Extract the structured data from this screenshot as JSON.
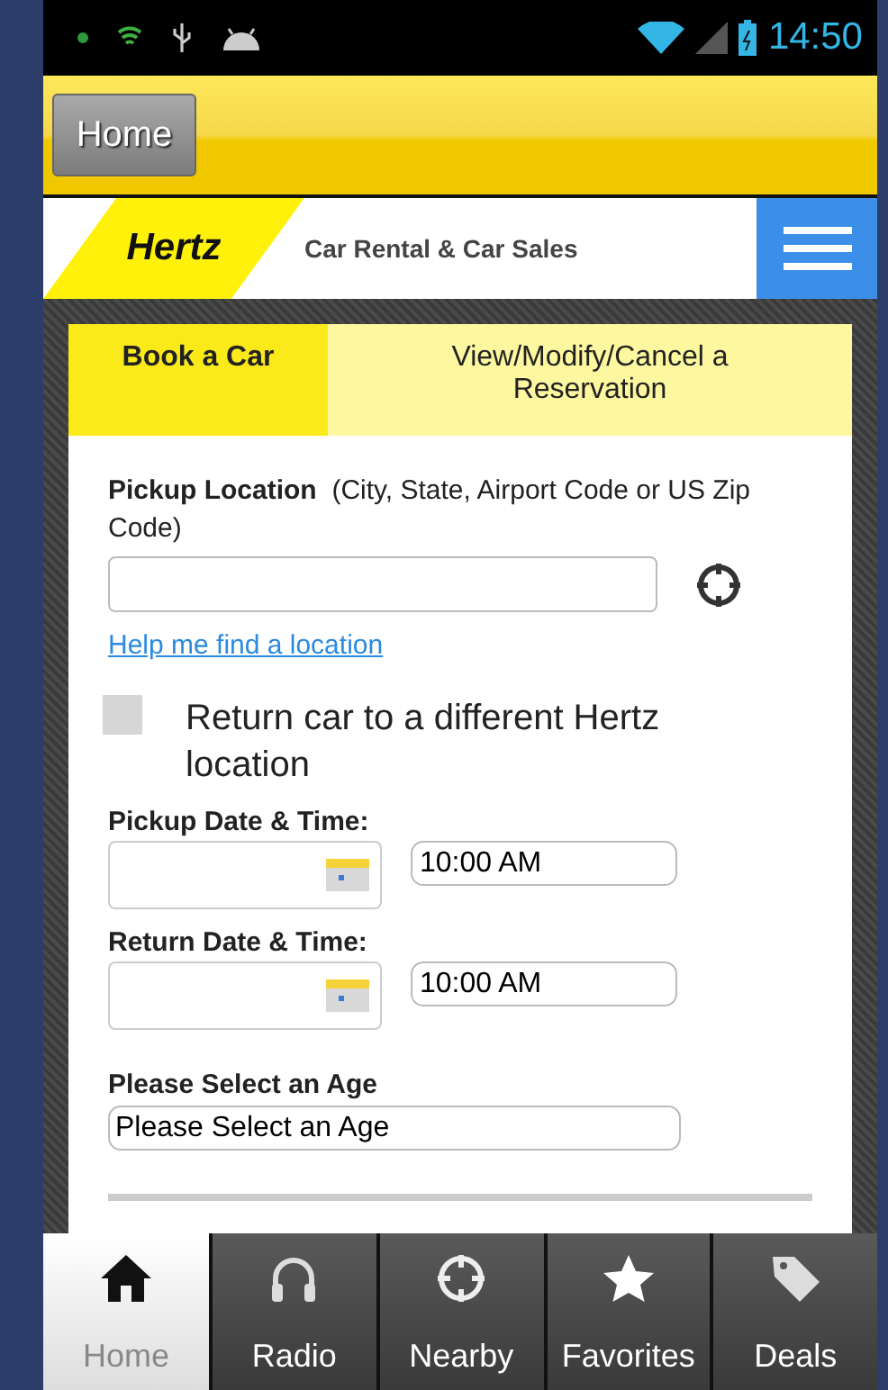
{
  "status_bar": {
    "time": "14:50"
  },
  "header": {
    "home_button": "Home"
  },
  "brand": {
    "logo": "Hertz",
    "tagline": "Car Rental & Car Sales"
  },
  "tabs": [
    {
      "label": "Book a Car",
      "selected": true
    },
    {
      "label": "View/Modify/Cancel a Reservation",
      "selected": false
    }
  ],
  "form": {
    "pickup_label": "Pickup Location",
    "pickup_hint": "(City, State, Airport Code or US Zip Code)",
    "help_link": "Help me find a location",
    "return_checkbox": {
      "label": "Return car to a different Hertz location",
      "checked": false
    },
    "pickup_datetime": {
      "label": "Pickup Date & Time:",
      "time": "10:00 AM"
    },
    "return_datetime": {
      "label": "Return Date & Time:",
      "time": "10:00 AM"
    },
    "age": {
      "label": "Please Select an Age",
      "value": "Please Select an Age"
    }
  },
  "bottom_nav": [
    {
      "label": "Home",
      "kind": "home",
      "selected": true
    },
    {
      "label": "Radio",
      "kind": "radio",
      "selected": false
    },
    {
      "label": "Nearby",
      "kind": "nearby",
      "selected": false
    },
    {
      "label": "Favorites",
      "kind": "favorites",
      "selected": false
    },
    {
      "label": "Deals",
      "kind": "deals",
      "selected": false
    }
  ]
}
